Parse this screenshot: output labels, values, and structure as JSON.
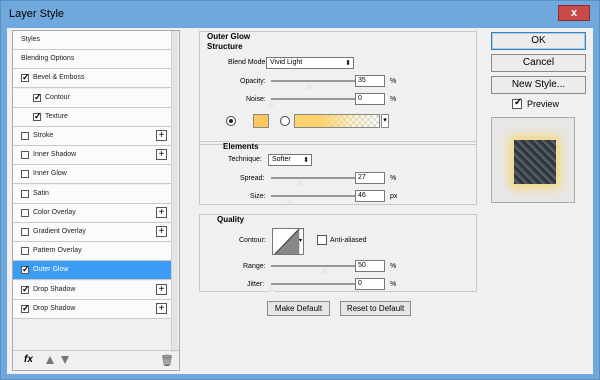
{
  "window": {
    "title": "Layer Style",
    "close_label": "x"
  },
  "sidebar": {
    "items": [
      {
        "label": "Styles",
        "checkbox": false,
        "checked": false,
        "plus": false,
        "indent": 0,
        "selected": false
      },
      {
        "label": "Blending Options",
        "checkbox": false,
        "checked": false,
        "plus": false,
        "indent": 0,
        "selected": false
      },
      {
        "label": "Bevel & Emboss",
        "checkbox": true,
        "checked": true,
        "plus": false,
        "indent": 0,
        "selected": false
      },
      {
        "label": "Contour",
        "checkbox": true,
        "checked": true,
        "plus": false,
        "indent": 1,
        "selected": false
      },
      {
        "label": "Texture",
        "checkbox": true,
        "checked": true,
        "plus": false,
        "indent": 1,
        "selected": false
      },
      {
        "label": "Stroke",
        "checkbox": true,
        "checked": false,
        "plus": true,
        "indent": 0,
        "selected": false
      },
      {
        "label": "Inner Shadow",
        "checkbox": true,
        "checked": false,
        "plus": true,
        "indent": 0,
        "selected": false
      },
      {
        "label": "Inner Glow",
        "checkbox": true,
        "checked": false,
        "plus": false,
        "indent": 0,
        "selected": false
      },
      {
        "label": "Satin",
        "checkbox": true,
        "checked": false,
        "plus": false,
        "indent": 0,
        "selected": false
      },
      {
        "label": "Color Overlay",
        "checkbox": true,
        "checked": false,
        "plus": true,
        "indent": 0,
        "selected": false
      },
      {
        "label": "Gradient Overlay",
        "checkbox": true,
        "checked": false,
        "plus": true,
        "indent": 0,
        "selected": false
      },
      {
        "label": "Pattern Overlay",
        "checkbox": true,
        "checked": false,
        "plus": false,
        "indent": 0,
        "selected": false
      },
      {
        "label": "Outer Glow",
        "checkbox": true,
        "checked": true,
        "plus": false,
        "indent": 0,
        "selected": true
      },
      {
        "label": "Drop Shadow",
        "checkbox": true,
        "checked": true,
        "plus": true,
        "indent": 0,
        "selected": false
      },
      {
        "label": "Drop Shadow",
        "checkbox": true,
        "checked": true,
        "plus": true,
        "indent": 0,
        "selected": false
      }
    ],
    "footer": {
      "fx_label": "fx"
    }
  },
  "outer_glow": {
    "section_title": "Outer Glow",
    "structure": {
      "title": "Structure",
      "blend_mode_label": "Blend Mode:",
      "blend_mode_value": "Vivid Light",
      "opacity_label": "Opacity:",
      "opacity_value": "35",
      "opacity_fraction": 0.35,
      "noise_label": "Noise:",
      "noise_value": "0",
      "noise_fraction": 0.0,
      "unit": "%",
      "color_hex": "#fcc661",
      "gradient_color_hex": "#fcd36c"
    },
    "elements": {
      "title": "Elements",
      "technique_label": "Technique:",
      "technique_value": "Softer",
      "spread_label": "Spread:",
      "spread_value": "27",
      "spread_fraction": 0.27,
      "size_label": "Size:",
      "size_value": "46",
      "size_fraction": 0.18,
      "spread_unit": "%",
      "size_unit": "px"
    },
    "quality": {
      "title": "Quality",
      "contour_label": "Contour:",
      "antialiased_label": "Anti-aliased",
      "antialiased_checked": false,
      "range_label": "Range:",
      "range_value": "50",
      "range_fraction": 0.5,
      "jitter_label": "Jitter:",
      "jitter_value": "0",
      "jitter_fraction": 0.0,
      "unit": "%"
    },
    "make_default_label": "Make Default",
    "reset_default_label": "Reset to Default"
  },
  "actions": {
    "ok_label": "OK",
    "cancel_label": "Cancel",
    "new_style_label": "New Style...",
    "preview_label": "Preview",
    "preview_checked": true
  }
}
